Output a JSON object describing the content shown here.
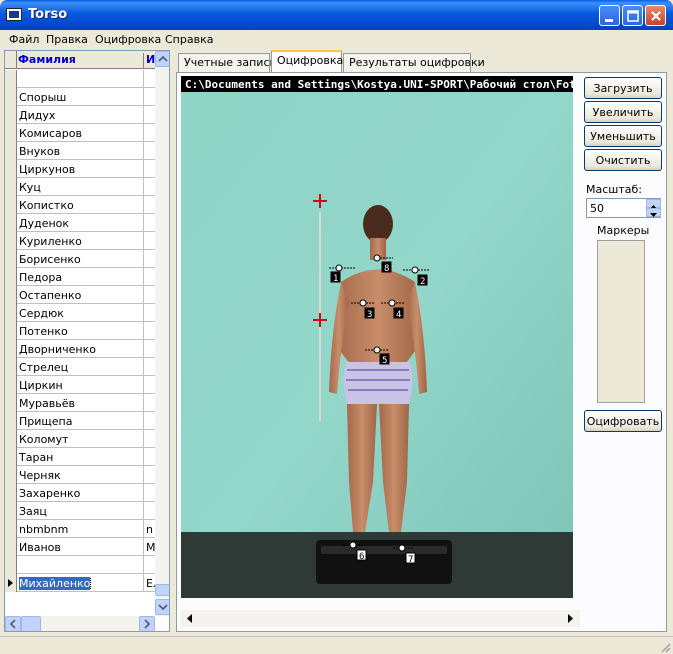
{
  "window": {
    "title": "Torso"
  },
  "menu": [
    "Файл",
    "Правка",
    "Оцифровка",
    "Справка"
  ],
  "grid": {
    "headers": {
      "surname": "Фамилия",
      "name": "И"
    },
    "rows": [
      {
        "surname": "",
        "name": ""
      },
      {
        "surname": "Спорыш",
        "name": ""
      },
      {
        "surname": "Дидух",
        "name": ""
      },
      {
        "surname": "Комисаров",
        "name": ""
      },
      {
        "surname": "Внуков",
        "name": ""
      },
      {
        "surname": "Циркунов",
        "name": ""
      },
      {
        "surname": "Куц",
        "name": ""
      },
      {
        "surname": "Копистко",
        "name": ""
      },
      {
        "surname": "Дуденок",
        "name": ""
      },
      {
        "surname": "Куриленко",
        "name": ""
      },
      {
        "surname": "Борисенко",
        "name": ""
      },
      {
        "surname": "Педора",
        "name": ""
      },
      {
        "surname": "Остапенко",
        "name": ""
      },
      {
        "surname": "Сердюк",
        "name": ""
      },
      {
        "surname": "Потенко",
        "name": ""
      },
      {
        "surname": "Дворниченко",
        "name": ""
      },
      {
        "surname": "Стрелец",
        "name": ""
      },
      {
        "surname": "Циркин",
        "name": ""
      },
      {
        "surname": "Муравьёв",
        "name": ""
      },
      {
        "surname": "Прищепа",
        "name": ""
      },
      {
        "surname": "Коломут",
        "name": ""
      },
      {
        "surname": "Таран",
        "name": ""
      },
      {
        "surname": "Черняк",
        "name": ""
      },
      {
        "surname": "Захаренко",
        "name": ""
      },
      {
        "surname": "Заяц",
        "name": ""
      },
      {
        "surname": "nbmbnm",
        "name": "n"
      },
      {
        "surname": "Иванов",
        "name": "М"
      },
      {
        "surname": "",
        "name": ""
      },
      {
        "surname": "Михайленко",
        "name": "Ел"
      }
    ],
    "selected_surname": "Михайленко"
  },
  "tabs": [
    {
      "label": "Учетные записи",
      "active": false
    },
    {
      "label": "Оцифровка",
      "active": true
    },
    {
      "label": "Результаты оцифровки",
      "active": false
    }
  ],
  "photo": {
    "path": "C:\\Documents and Settings\\Kostya.UNI-SPORT\\Рабочий стол\\Foto",
    "markers": [
      "1",
      "2",
      "3",
      "4",
      "5",
      "6",
      "7",
      "8"
    ]
  },
  "right_panel": {
    "load_label": "Загрузить",
    "zoom_in_label": "Увеличить",
    "zoom_out_label": "Уменьшить",
    "clear_label": "Очистить",
    "scale_label": "Масштаб:",
    "scale_value": "50",
    "markers_label": "Маркеры",
    "digitize_label": "Оцифровать"
  },
  "colors": {
    "wall": "#8fcfc3",
    "marker_crosshair": "#e0001c",
    "selection": "#316ac5",
    "header_text": "#0000cc"
  }
}
